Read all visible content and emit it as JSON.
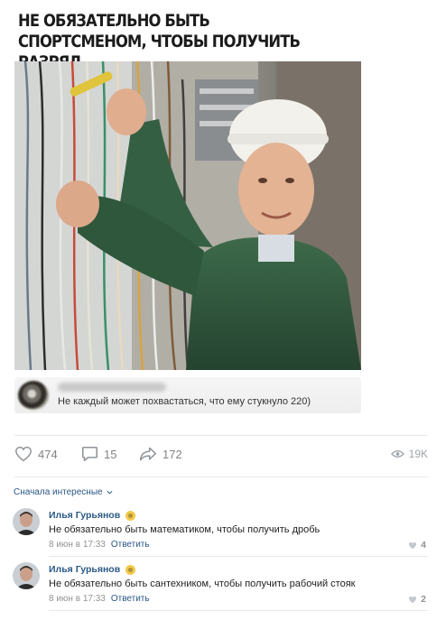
{
  "meme": {
    "title": "НЕ ОБЯЗАТЕЛЬНО БЫТЬ СПОРТСМЕНОМ, ЧТОБЫ ПОЛУЧИТЬ РАЗРЯД"
  },
  "embedded_comment": {
    "text": "Не каждый может похвастаться, что ему стукнуло 220)"
  },
  "post_actions": {
    "likes": "474",
    "comments": "15",
    "shares": "172",
    "views": "19K"
  },
  "comments_section": {
    "sort_label": "Сначала интересные",
    "items": [
      {
        "author": "Илья Гурьянов",
        "text": "Не обязательно быть математиком, чтобы получить дробь",
        "date": "8 июн в 17:33",
        "reply_label": "Ответить",
        "likes": "4"
      },
      {
        "author": "Илья Гурьянов",
        "text": "Не обязательно быть сантехником, чтобы получить рабочий стояк",
        "date": "8 июн в 17:33",
        "reply_label": "Ответить",
        "likes": "2"
      }
    ]
  },
  "colors": {
    "link": "#2a5885",
    "muted": "#828282",
    "divider": "#e7e8ec"
  },
  "icons": [
    "heart-icon",
    "comment-icon",
    "share-icon",
    "eye-icon",
    "chevron-down-icon",
    "sticker-badge-icon"
  ]
}
